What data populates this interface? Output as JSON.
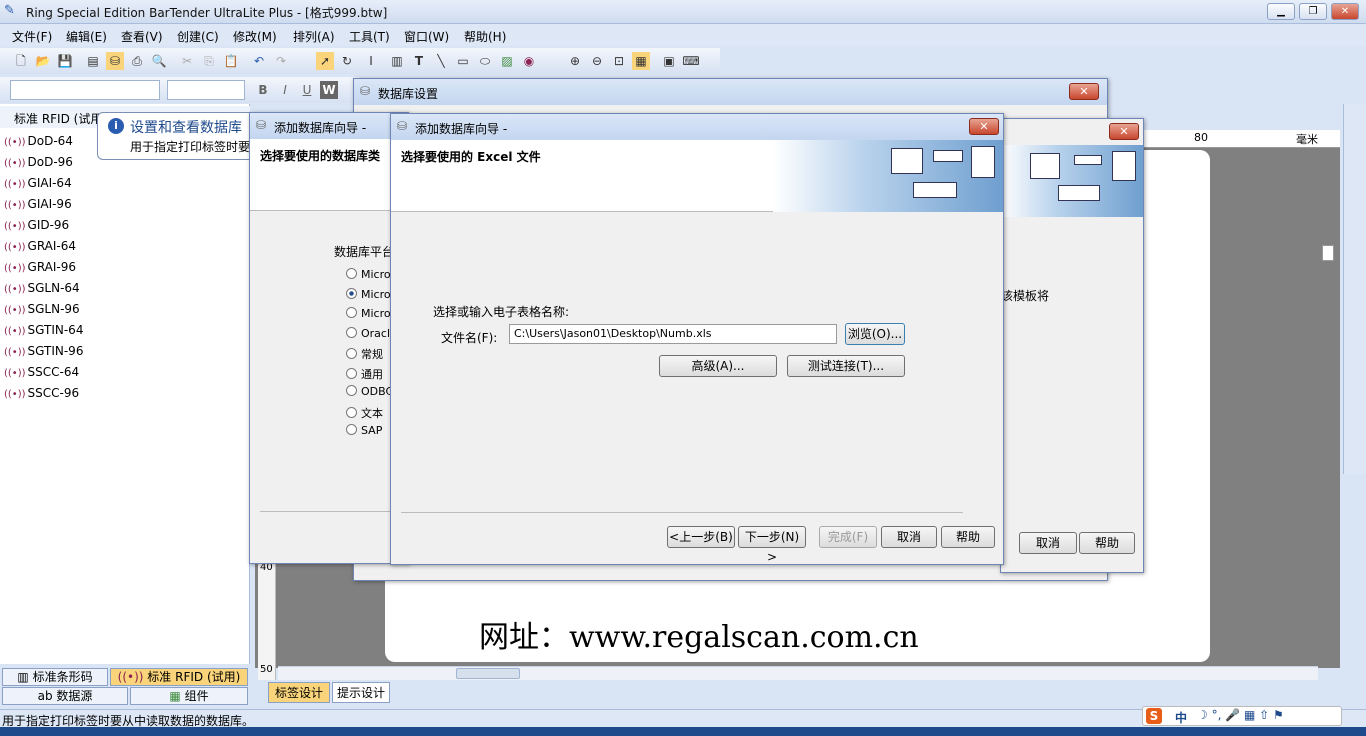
{
  "app": {
    "title": "Ring Special Edition BarTender UltraLite Plus - [格式999.btw]"
  },
  "menu": [
    "文件(F)",
    "编辑(E)",
    "查看(V)",
    "创建(C)",
    "修改(M)",
    "排列(A)",
    "工具(T)",
    "窗口(W)",
    "帮助(H)"
  ],
  "tooltip": {
    "title": "设置和查看数据库",
    "body": "用于指定打印标签时要"
  },
  "left_panel": {
    "header": "标准 RFID (试用",
    "items": [
      "DoD-64",
      "DoD-96",
      "GIAI-64",
      "GIAI-96",
      "GID-96",
      "GRAI-64",
      "GRAI-96",
      "SGLN-64",
      "SGLN-96",
      "SGTIN-64",
      "SGTIN-96",
      "SSCC-64",
      "SSCC-96"
    ]
  },
  "bottom_tabs": {
    "barcode": "标准条形码",
    "rfid": "标准 RFID (试用)",
    "datasource": "数据源",
    "component": "组件"
  },
  "design_tabs": [
    "标签设计",
    "提示设计"
  ],
  "status_text": "用于指定打印标签时要从中读取数据的数据库。",
  "label": {
    "url": "网址：www.regalscan.com.cn"
  },
  "ruler": {
    "h80": "80",
    "unit": "毫米",
    "v40": "40",
    "v50": "50"
  },
  "db_settings": {
    "title": "数据库设置",
    "partial_text": "该模板将",
    "cancel": "取消",
    "help": "帮助"
  },
  "wizard_back": {
    "title": "添加数据库向导 -",
    "heading": "选择要使用的数据库类",
    "platform_label": "数据库平台",
    "options": [
      "Micro",
      "Micro",
      "Micro",
      "Oracl",
      "常规",
      "通用",
      "ODBC",
      "文本",
      "SAP"
    ]
  },
  "wizard_front": {
    "title": "添加数据库向导 -",
    "heading": "选择要使用的 Excel 文件",
    "prompt": "选择或输入电子表格名称:",
    "file_label": "文件名(F):",
    "file_value": "C:\\Users\\Jason01\\Desktop\\Numb.xls",
    "browse": "浏览(O)...",
    "advanced": "高级(A)...",
    "test": "测试连接(T)...",
    "back": "<上一步(B)",
    "next": "下一步(N) >",
    "finish": "完成(F)",
    "cancel": "取消",
    "help": "帮助"
  },
  "ime": {
    "lang": "中"
  },
  "colors": {
    "accent": "#2a5db0",
    "close": "#c8462e"
  }
}
